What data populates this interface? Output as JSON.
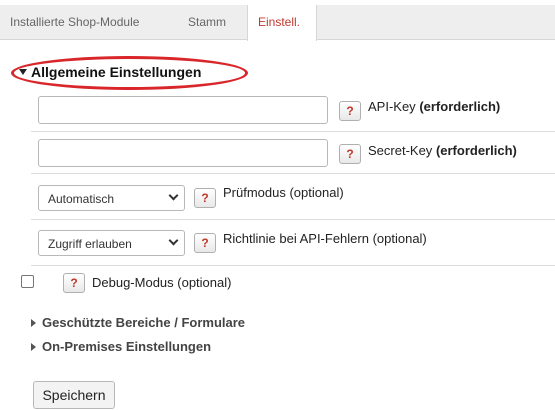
{
  "tabs": [
    {
      "label": "Installierte Shop-Module"
    },
    {
      "label": "Stamm"
    },
    {
      "label": "Einstell.",
      "active": true
    }
  ],
  "section": {
    "title": "Allgemeine Einstellungen",
    "expanded": true
  },
  "fields": {
    "api_key": {
      "value": "",
      "label": "API-Key",
      "label_suffix": "(erforderlich)"
    },
    "secret_key": {
      "value": "",
      "label": "Secret-Key",
      "label_suffix": "(erforderlich)"
    },
    "test_mode": {
      "selected": "Automatisch",
      "label": "Prüfmodus (optional)"
    },
    "api_error_policy": {
      "selected": "Zugriff erlauben",
      "label": "Richtlinie bei API-Fehlern (optional)"
    },
    "debug_mode": {
      "checked": false,
      "label": "Debug-Modus (optional)"
    }
  },
  "help_button_label": "?",
  "collapsed_sections": [
    {
      "title": "Geschützte Bereiche / Formulare"
    },
    {
      "title": "On-Premises Einstellungen"
    }
  ],
  "save_label": "Speichern",
  "colors": {
    "accent": "#c0392b",
    "highlight_ring": "#d9262b"
  }
}
